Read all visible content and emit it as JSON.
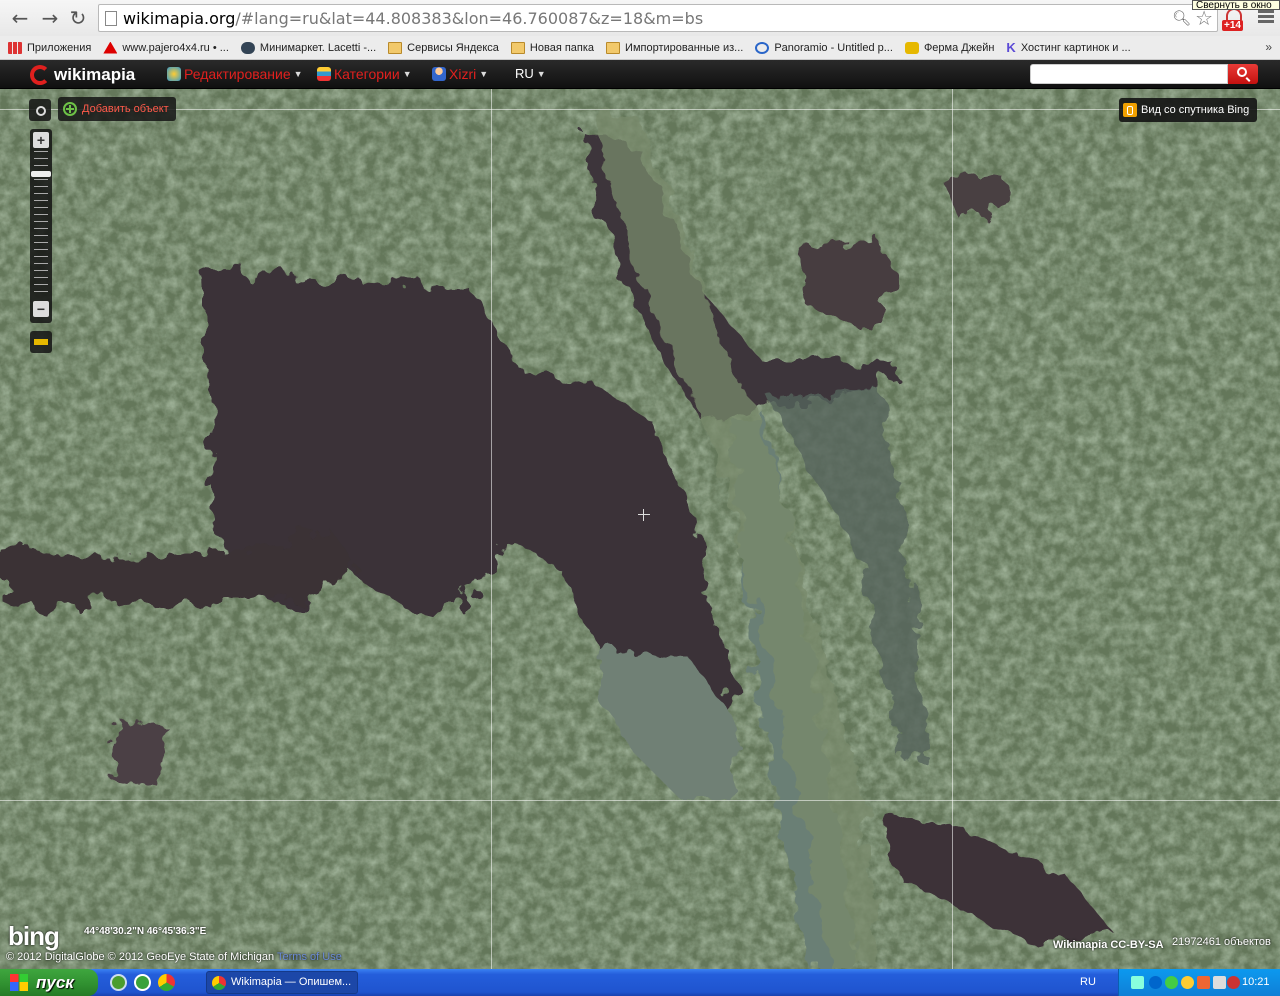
{
  "browser": {
    "url_host": "wikimapia.org",
    "url_path": "/#lang=ru&lat=44.808383&lon=46.760087&z=18&m=bs",
    "tooltip": "Свернуть в окно",
    "extension_badge": "+14",
    "bookmarks": [
      {
        "label": "Приложения",
        "icon": "apps-icon"
      },
      {
        "label": "www.pajero4x4.ru • ...",
        "icon": "mitsubishi-icon"
      },
      {
        "label": "Минимаркет. Lacetti -...",
        "icon": "car-icon"
      },
      {
        "label": "Сервисы Яндекса",
        "icon": "folder-icon"
      },
      {
        "label": "Новая папка",
        "icon": "folder-icon"
      },
      {
        "label": "Импортированные из...",
        "icon": "folder-icon"
      },
      {
        "label": "Panoramio - Untitled p...",
        "icon": "panoramio-icon"
      },
      {
        "label": "Ферма Джейн",
        "icon": "farm-icon"
      },
      {
        "label": "Хостинг картинок и ...",
        "icon": "k-icon"
      }
    ],
    "bookmarks_more": "»"
  },
  "wikimapia": {
    "logo_text": "wikimapia",
    "menu": {
      "edit": "Редактирование",
      "categories": "Категории",
      "user": "Xizri",
      "language": "RU"
    },
    "search_placeholder": "",
    "add_object": "Добавить объект",
    "layer_button": "Вид со спутника Bing",
    "zoom_level": 18
  },
  "map": {
    "bing_logo": "bing",
    "coordinates": "44°48'30.2\"N 46°45'36.3\"E",
    "copyright": "© 2012 DigitalGlobe © 2012 GeoEye State of Michigan",
    "terms": "Terms of Use",
    "license": "Wikimapia CC-BY-SA",
    "object_count": "21972461 объектов"
  },
  "taskbar": {
    "start_label": "пуск",
    "task_title": "Wikimapia — Опишем...",
    "language": "RU",
    "clock": "10:21"
  }
}
